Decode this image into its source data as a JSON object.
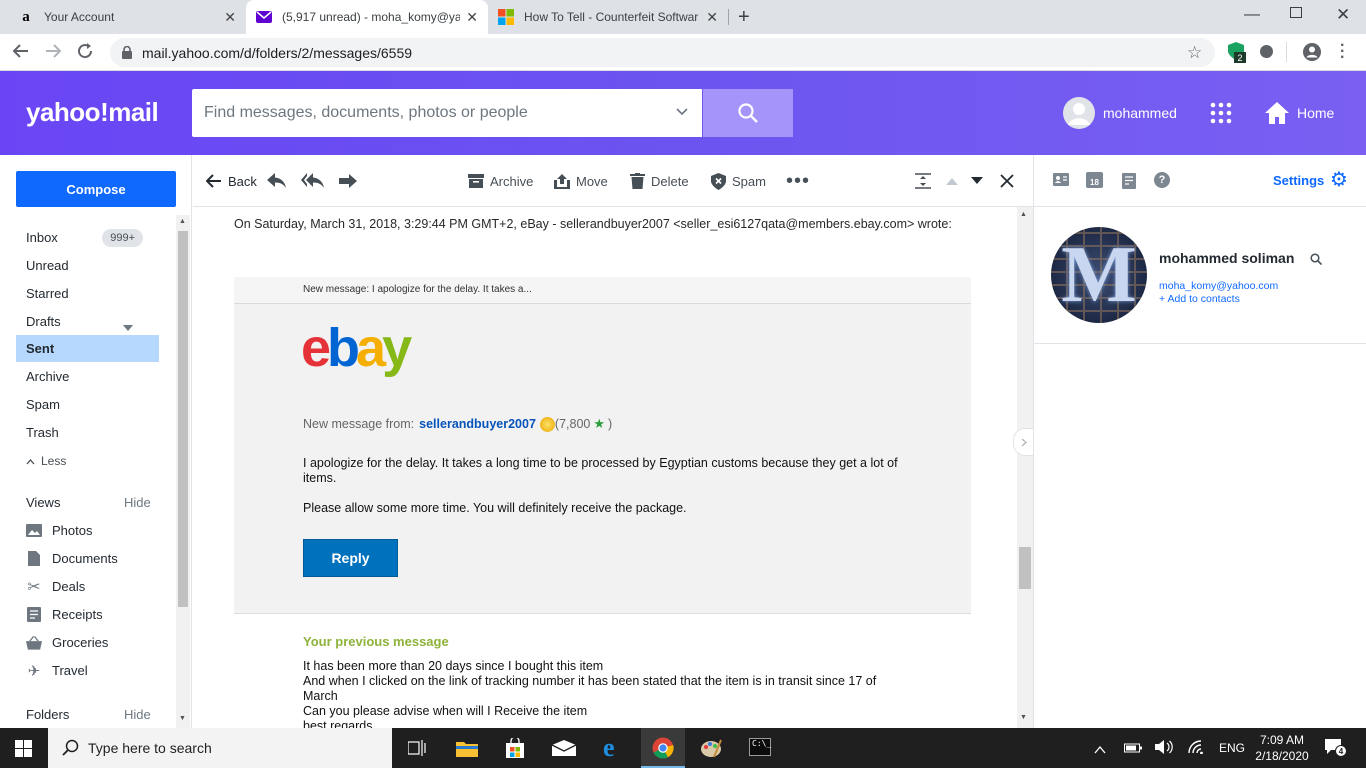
{
  "browser": {
    "tabs": [
      {
        "title": "Your Account",
        "icon": "amazon-a"
      },
      {
        "title": "(5,917 unread) - moha_komy@ya",
        "icon": "yahoo-mail-envelope"
      },
      {
        "title": "How To Tell - Counterfeit Softwar",
        "icon": "microsoft-logo"
      }
    ],
    "url": "mail.yahoo.com/d/folders/2/messages/6559",
    "ext_badge": "2"
  },
  "header": {
    "logo": "yahoo!mail",
    "search_placeholder": "Find messages, documents, photos or people",
    "user": "mohammed",
    "home": "Home"
  },
  "sidebar": {
    "compose": "Compose",
    "folders": [
      {
        "label": "Inbox",
        "badge": "999+"
      },
      {
        "label": "Unread"
      },
      {
        "label": "Starred"
      },
      {
        "label": "Drafts"
      },
      {
        "label": "Sent"
      },
      {
        "label": "Archive"
      },
      {
        "label": "Spam"
      },
      {
        "label": "Trash"
      }
    ],
    "less": "Less",
    "views_title": "Views",
    "views_hide": "Hide",
    "views": [
      "Photos",
      "Documents",
      "Deals",
      "Receipts",
      "Groceries",
      "Travel"
    ],
    "folders_title": "Folders",
    "folders_hide": "Hide"
  },
  "toolbar": {
    "back": "Back",
    "archive": "Archive",
    "move": "Move",
    "delete": "Delete",
    "spam": "Spam"
  },
  "message": {
    "quote_header": "On Saturday, March 31, 2018, 3:29:44 PM GMT+2, eBay - sellerandbuyer2007 <seller_esi6127qata@members.ebay.com> wrote:",
    "preheader": "New message: I apologize for the delay. It takes a...",
    "ebay_letters": [
      "e",
      "b",
      "a",
      "y"
    ],
    "from_label": "New message from:",
    "from_user": "sellerandbuyer2007",
    "rating_open": "(7,800",
    "rating_close": ")",
    "body_p1": "I apologize for the delay. It takes a long time to be processed by Egyptian customs because they get a lot of items.",
    "body_p2": "Please allow some more time. You will definitely receive the package.",
    "reply": "Reply",
    "prev_title": "Your previous message",
    "prev_lines": [
      "It has been more than 20 days since I bought this item",
      "And when I clicked on the link of tracking number it has been stated that the item is in transit since 17 of March",
      "Can you please advise when will I Receive the item",
      "best regards"
    ]
  },
  "rightpane": {
    "settings": "Settings",
    "calendar_day": "18",
    "contact_name": "mohammed soliman",
    "contact_email": "moha_komy@yahoo.com",
    "add_contact": "+ Add to contacts",
    "avatar_letter": "M"
  },
  "taskbar": {
    "search_placeholder": "Type here to search",
    "lang": "ENG",
    "time": "7:09 AM",
    "date": "2/18/2020",
    "notif_count": "4"
  },
  "colors": {
    "yahoo_purple": "#6a45f5",
    "compose_blue": "#0f69ff",
    "ebay_red": "#e53238",
    "ebay_blue": "#0064d2",
    "ebay_yellow": "#f5af02",
    "ebay_green": "#86b817",
    "reply_blue": "#0071bc",
    "prev_green": "#8db33a"
  }
}
